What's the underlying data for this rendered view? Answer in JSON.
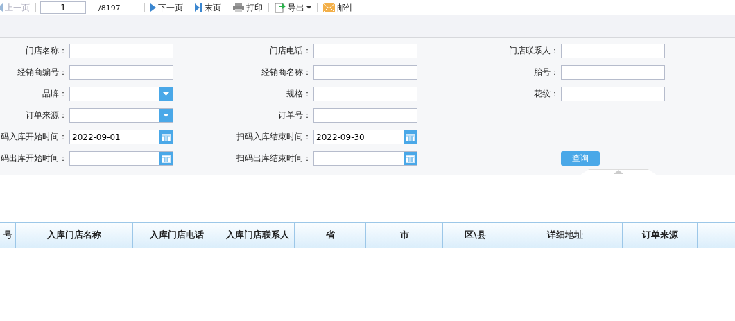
{
  "toolbar": {
    "items": [
      {
        "kind": "prev",
        "label": "上一页",
        "disabled": true
      },
      {
        "kind": "page",
        "value": "1",
        "total": "/8197"
      },
      {
        "kind": "next",
        "label": "下一页",
        "disabled": false
      },
      {
        "kind": "last",
        "label": "末页",
        "disabled": false
      },
      {
        "kind": "print",
        "label": "打印",
        "disabled": false
      },
      {
        "kind": "export",
        "label": "导出",
        "disabled": false
      },
      {
        "kind": "mail",
        "label": "邮件",
        "disabled": false
      }
    ]
  },
  "form": {
    "rows": [
      [
        {
          "label": "门店名称：",
          "kind": "text"
        },
        {
          "label": "门店电话：",
          "kind": "text"
        },
        {
          "label": "门店联系人：",
          "kind": "text"
        }
      ],
      [
        {
          "label": "经销商编号：",
          "kind": "text"
        },
        {
          "label": "经销商名称：",
          "kind": "text"
        },
        {
          "label": "胎号：",
          "kind": "text"
        }
      ],
      [
        {
          "label": "品牌：",
          "kind": "select"
        },
        {
          "label": "规格：",
          "kind": "text"
        },
        {
          "label": "花纹：",
          "kind": "text"
        }
      ],
      [
        {
          "label": "订单来源：",
          "kind": "select"
        },
        {
          "label": "订单号：",
          "kind": "text"
        }
      ],
      [
        {
          "label": "码入库开始时间：",
          "kind": "date",
          "value": "2022-09-01"
        },
        {
          "label": "扫码入库结束时间：",
          "kind": "date",
          "value": "2022-09-30"
        }
      ],
      [
        {
          "label": "码出库开始时间：",
          "kind": "date"
        },
        {
          "label": "扫码出库结束时间：",
          "kind": "date"
        }
      ]
    ],
    "query_button": "查询"
  },
  "table": {
    "columns": [
      "号",
      "入库门店名称",
      "入库门店电话",
      "入库门店联系人",
      "省",
      "市",
      "区\\县",
      "详细地址",
      "订单来源"
    ]
  }
}
